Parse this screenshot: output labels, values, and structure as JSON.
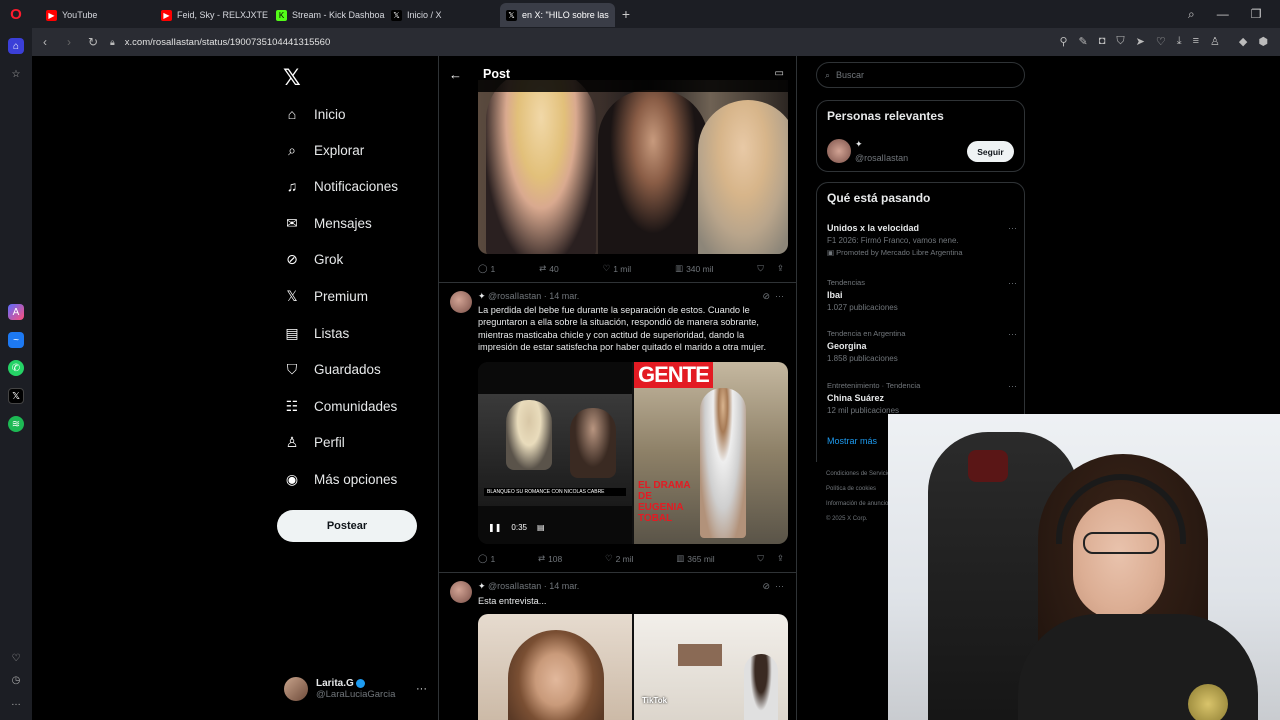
{
  "browser": {
    "tabs": [
      {
        "label": "YouTube",
        "color": "#ff0000"
      },
      {
        "label": "Feid, Sky - RELXJXTE - Yo",
        "color": "#ff0000"
      },
      {
        "label": "Stream - Kick Dashboard",
        "color": "#53fc18"
      },
      {
        "label": "Inicio / X",
        "color": "#000000"
      },
      {
        "label": "en X: \"HILO sobre las",
        "color": "#000000",
        "active": true
      }
    ],
    "url": "x.com/rosalIastan/status/1900735104441315560"
  },
  "x_nav": {
    "items": [
      {
        "label": "Inicio",
        "icon": "home-icon"
      },
      {
        "label": "Explorar",
        "icon": "search-icon"
      },
      {
        "label": "Notificaciones",
        "icon": "bell-icon"
      },
      {
        "label": "Mensajes",
        "icon": "mail-icon"
      },
      {
        "label": "Grok",
        "icon": "grok-icon"
      },
      {
        "label": "Premium",
        "icon": "x-icon"
      },
      {
        "label": "Listas",
        "icon": "list-icon"
      },
      {
        "label": "Guardados",
        "icon": "bookmark-icon"
      },
      {
        "label": "Comunidades",
        "icon": "communities-icon"
      },
      {
        "label": "Perfil",
        "icon": "person-icon"
      },
      {
        "label": "Más opciones",
        "icon": "more-circle-icon"
      }
    ],
    "post_button": "Postear",
    "account": {
      "name": "Larita.G",
      "handle": "@LaraLuciaGarcia"
    }
  },
  "post": {
    "header_title": "Post",
    "tweets": [
      {
        "replies": "1",
        "retweets": "40",
        "likes": "1 mil",
        "views": "340 mil"
      },
      {
        "handle": "@rosalIastan",
        "date": "14 mar.",
        "text": "La perdida del bebe fue durante la separación de estos. Cuando le preguntaron a ella sobre la situación, respondió de manera sobrante, mientras masticaba chicle y con actitud de superioridad, dando la impresión de estar satisfecha por haber quitado el marido a otra mujer.",
        "video_time": "0:35",
        "magazine": "GENTE",
        "magazine_headline": "EL DRAMA DE EUGENIA TOBAL",
        "caption": "BLANQUEO SU ROMANCE CON NICOLAS CABRE",
        "replies": "1",
        "retweets": "108",
        "likes": "2 mil",
        "views": "365 mil"
      },
      {
        "handle": "@rosalIastan",
        "date": "14 mar.",
        "text": "Esta entrevista...",
        "watermark": "TikTok"
      }
    ]
  },
  "right": {
    "search_placeholder": "Buscar",
    "relevant": {
      "title": "Personas relevantes",
      "handle": "@rosalIastan",
      "follow": "Seguir"
    },
    "trends": {
      "title": "Qué está pasando",
      "items": [
        {
          "cat": "",
          "name": "Unidos x la velocidad",
          "sub": "F1 2026: Firmó Franco, vamos nene.",
          "promo": "Promoted by Mercado Libre Argentina"
        },
        {
          "cat": "Tendencias",
          "name": "Ibai",
          "sub": "1.027 publicaciones"
        },
        {
          "cat": "Tendencia en Argentina",
          "name": "Georgina",
          "sub": "1.858 publicaciones"
        },
        {
          "cat": "Entretenimiento · Tendencia",
          "name": "China Suárez",
          "sub": "12 mil publicaciones"
        }
      ],
      "show_more": "Mostrar más"
    },
    "footer": [
      "Condiciones de Servicio",
      "Política de cookies",
      "Información de anuncios",
      "© 2025 X Corp."
    ]
  }
}
